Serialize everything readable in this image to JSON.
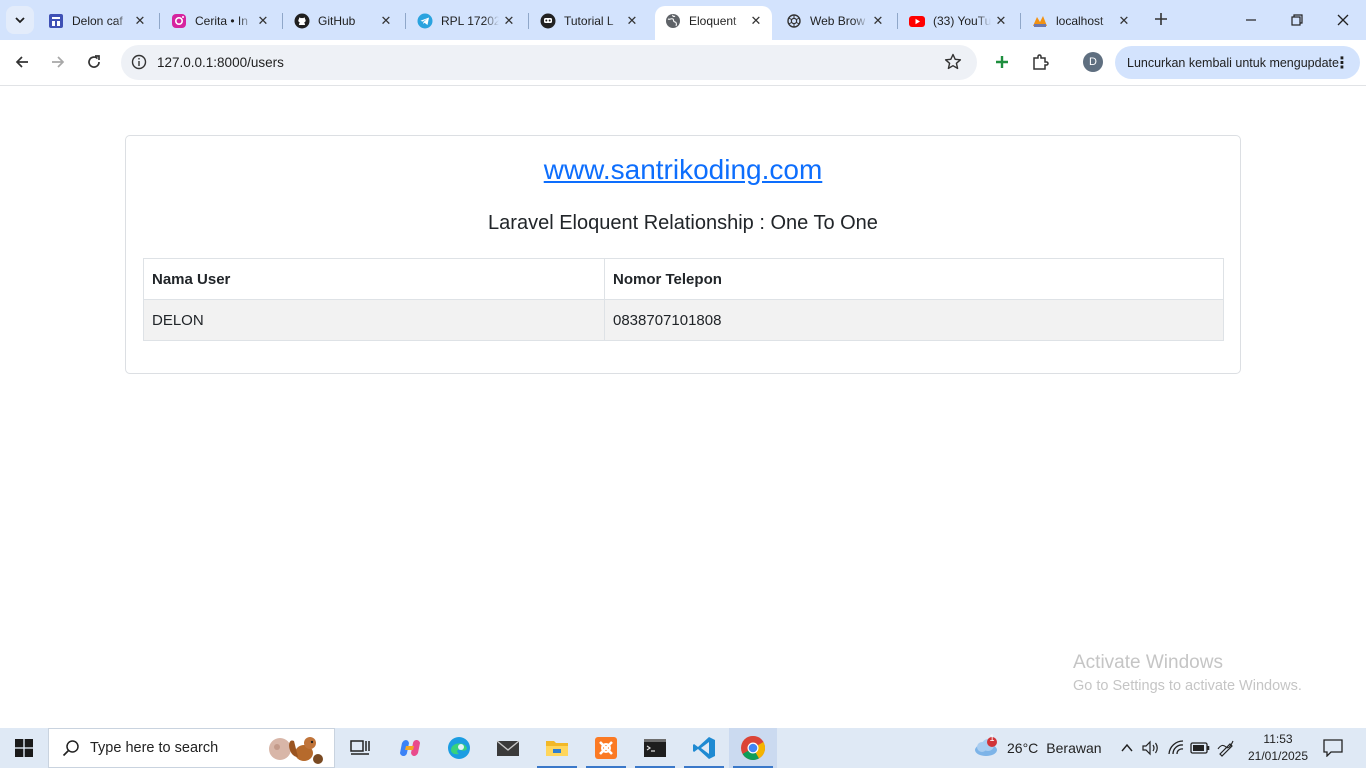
{
  "browser": {
    "tabs": [
      {
        "title": "Delon caf",
        "icon": "forms-icon",
        "active": false
      },
      {
        "title": "Cerita • In",
        "icon": "instagram-icon",
        "active": false
      },
      {
        "title": "GitHub",
        "icon": "github-icon",
        "active": false
      },
      {
        "title": "RPL 17202",
        "icon": "telegram-icon",
        "active": false
      },
      {
        "title": "Tutorial L",
        "icon": "tutorial-icon",
        "active": false
      },
      {
        "title": "Eloquent",
        "icon": "globe-icon",
        "active": true
      },
      {
        "title": "Web Brow",
        "icon": "chatgpt-icon",
        "active": false
      },
      {
        "title": "(33) YouTu",
        "icon": "youtube-icon",
        "active": false
      },
      {
        "title": "localhost",
        "icon": "phpmyadmin-icon",
        "active": false
      }
    ],
    "url": "127.0.0.1:8000/users",
    "profile_initial": "D",
    "relaunch_label": "Luncurkan kembali untuk mengupdate"
  },
  "page": {
    "site_link": "www.santrikoding.com",
    "subtitle": "Laravel Eloquent Relationship : One To One",
    "table": {
      "headers": [
        "Nama User",
        "Nomor Telepon"
      ],
      "rows": [
        [
          "DELON",
          "0838707101808"
        ]
      ]
    }
  },
  "watermark": {
    "line1": "Activate Windows",
    "line2": "Go to Settings to activate Windows."
  },
  "taskbar": {
    "search_placeholder": "Type here to search",
    "weather": {
      "temp": "26°C",
      "condition": "Berawan",
      "badge": "1"
    },
    "time": "11:53",
    "date": "21/01/2025"
  },
  "colors": {
    "tabstrip": "#d3e3fd",
    "link": "#0d6efd",
    "taskbar": "#dfe9f5"
  }
}
